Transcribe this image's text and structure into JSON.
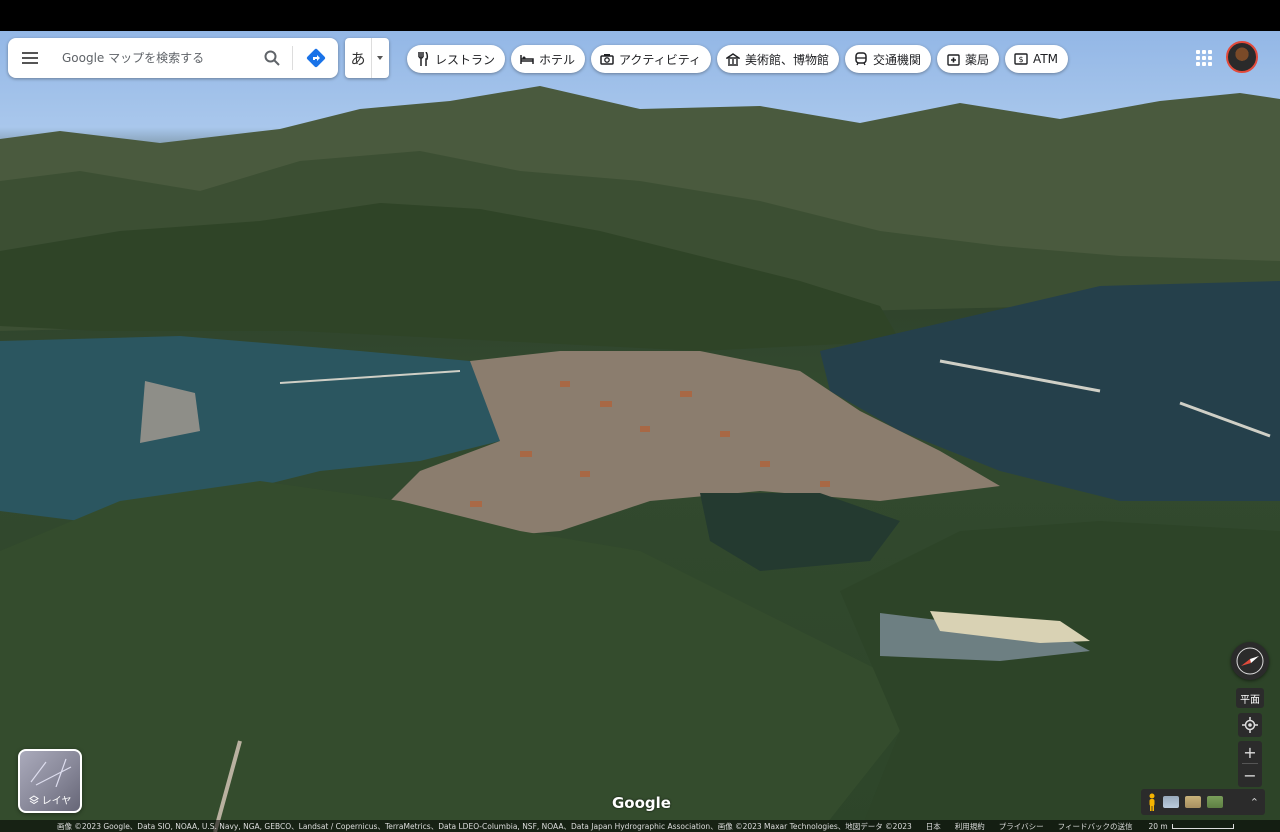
{
  "search": {
    "placeholder": "Google マップを検索する"
  },
  "ime": {
    "char": "あ"
  },
  "chips": [
    {
      "label": "レストラン",
      "icon": "restaurant-icon"
    },
    {
      "label": "ホテル",
      "icon": "hotel-icon"
    },
    {
      "label": "アクティビティ",
      "icon": "camera-icon"
    },
    {
      "label": "美術館、博物館",
      "icon": "museum-icon"
    },
    {
      "label": "交通機関",
      "icon": "transit-icon"
    },
    {
      "label": "薬局",
      "icon": "pharmacy-icon"
    },
    {
      "label": "ATM",
      "icon": "atm-icon"
    }
  ],
  "layers": {
    "label": "レイヤ"
  },
  "logo": {
    "text": "Google"
  },
  "controls": {
    "tilt_label": "平面"
  },
  "footer": {
    "attribution": "画像 ©2023 Google、Data SIO, NOAA, U.S. Navy, NGA, GEBCO、Landsat / Copernicus、TerraMetrics、Data LDEO-Columbia, NSF, NOAA、Data Japan Hydrographic Association、画像 ©2023 Maxar Technologies、地図データ ©2023",
    "links": [
      "日本",
      "利用規約",
      "プライバシー",
      "フィードバックの送信"
    ],
    "scale": "20 m"
  },
  "colors": {
    "accent": "#1a73e8",
    "avatar_ring": "#e24a3b",
    "control_bg": "#2b2b2b"
  }
}
